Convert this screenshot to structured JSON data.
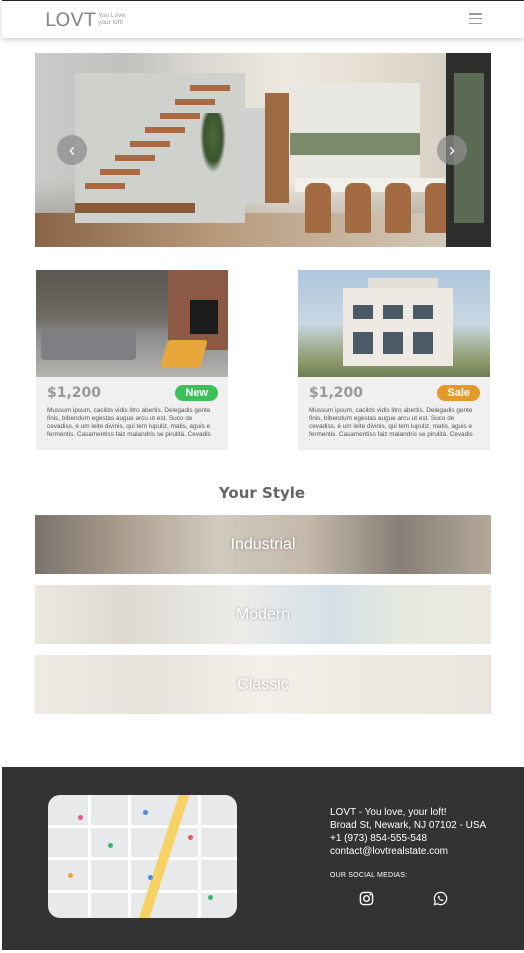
{
  "header": {
    "logo": "LOVT",
    "tagline_line1": "You Love,",
    "tagline_line2": "your loft!"
  },
  "hero": {
    "prev_label": "‹",
    "next_label": "›"
  },
  "listings": [
    {
      "price": "$1,200",
      "badge": "New",
      "badge_color": "#3dbf5b",
      "description": "Mussum ipsum, cacilds vidis litro abertis. Delegadis gente finis, bibendum egestas augue arcu ut est. Suco de cevadiss, é um leite divinis, qui tem lupuliz, matis, aguis e fermentis. Casamentiss faiz malandris se pirulitá. Cevadis im ampola pa"
    },
    {
      "price": "$1,200",
      "badge": "Sale",
      "badge_color": "#e39a2b",
      "description": "Mussum ipsum, cacilds vidis litro abertis. Delegadis gente finis, bibendum egestas augue arcu ut est. Suco de cevadiss, é um leite divinis, qui tem lupuliz, matis, aguis e fermentis. Casamentiss faiz malandris se pirulitá. Cevadis im ampola pa"
    }
  ],
  "styles": {
    "title": "Your Style",
    "items": [
      "Industrial",
      "Modern",
      "Classic"
    ]
  },
  "footer": {
    "company": "LOVT - You love, your loft!",
    "address": "Broad St, Newark, NJ 07102 - USA",
    "phone": "+1 (973) 854-555-548",
    "email": "contact@lovtrealstate.com",
    "social_label": "OUR SOCIAL MEDIAS:",
    "social_icons": [
      "instagram-icon",
      "whatsapp-icon"
    ]
  }
}
